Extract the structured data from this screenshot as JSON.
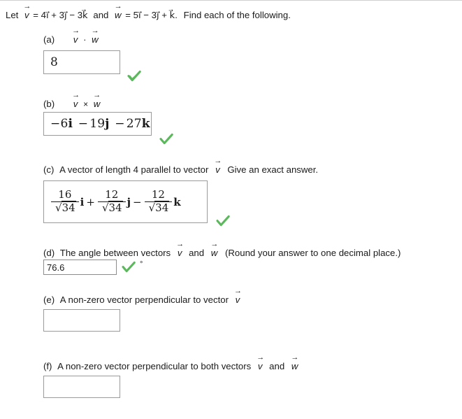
{
  "header": {
    "text_before_v": "Let",
    "v_symbol": "v",
    "v_definition": "= 4i⃗ + 3j⃗ − 3k⃗",
    "and_text": "and",
    "w_symbol": "w",
    "w_definition": "= 5i⃗ − 3j⃗ + k⃗.",
    "instruction": "Find each of the following.",
    "full_text": "Let v = 4i + 3j − 3k and w = 5i − 3j + k. Find each of the following."
  },
  "colors": {
    "check_green": "#5cb85c",
    "box_border": "#9a9a9a",
    "input_border": "#8c8c8c",
    "page_background": "#ffffff",
    "text": "#1a1a1a"
  },
  "parts": {
    "a": {
      "label": "(a)",
      "expression_v": "v",
      "expression_op": "·",
      "expression_w": "w",
      "answer": "8",
      "status": "correct",
      "check_icon": "green-check-icon"
    },
    "b": {
      "label": "(b)",
      "expression_v": "v",
      "expression_op": "×",
      "expression_w": "w",
      "answer": "−6i − 19j − 27k",
      "answer_terms": [
        {
          "sign": "−",
          "coefficient": "6",
          "unit": "i"
        },
        {
          "sign": "−",
          "coefficient": "19",
          "unit": "j"
        },
        {
          "sign": "−",
          "coefficient": "27",
          "unit": "k"
        }
      ],
      "status": "correct",
      "check_icon": "green-check-icon"
    },
    "c": {
      "label": "(c)",
      "prompt_before": "A vector of length 4 parallel to vector",
      "prompt_vector": "v",
      "prompt_after": "Give an exact answer.",
      "answer_terms": [
        {
          "sign": "",
          "numerator": "16",
          "radical": "√",
          "radicand": "34",
          "unit": "i"
        },
        {
          "sign": "+",
          "numerator": "12",
          "radical": "√",
          "radicand": "34",
          "unit": "j"
        },
        {
          "sign": "−",
          "numerator": "12",
          "radical": "√",
          "radicand": "34",
          "unit": "k"
        }
      ],
      "status": "correct",
      "check_icon": "green-check-icon"
    },
    "d": {
      "label": "(d)",
      "prompt_before": "The angle between vectors",
      "prompt_vector_1": "v",
      "prompt_middle": "and",
      "prompt_vector_2": "w",
      "prompt_after": "(Round your answer to one decimal place.)",
      "answer": "76.6",
      "unit_symbol": "°",
      "placeholder": "",
      "status": "correct",
      "check_icon": "green-check-icon"
    },
    "e": {
      "label": "(e)",
      "prompt_before": "A non-zero vector perpendicular to vector",
      "prompt_vector": "v",
      "answer": "",
      "status": "empty"
    },
    "f": {
      "label": "(f)",
      "prompt_before": "A non-zero vector perpendicular to both vectors",
      "prompt_vector_1": "v",
      "prompt_middle": "and",
      "prompt_vector_2": "w",
      "answer": "",
      "status": "empty"
    }
  }
}
